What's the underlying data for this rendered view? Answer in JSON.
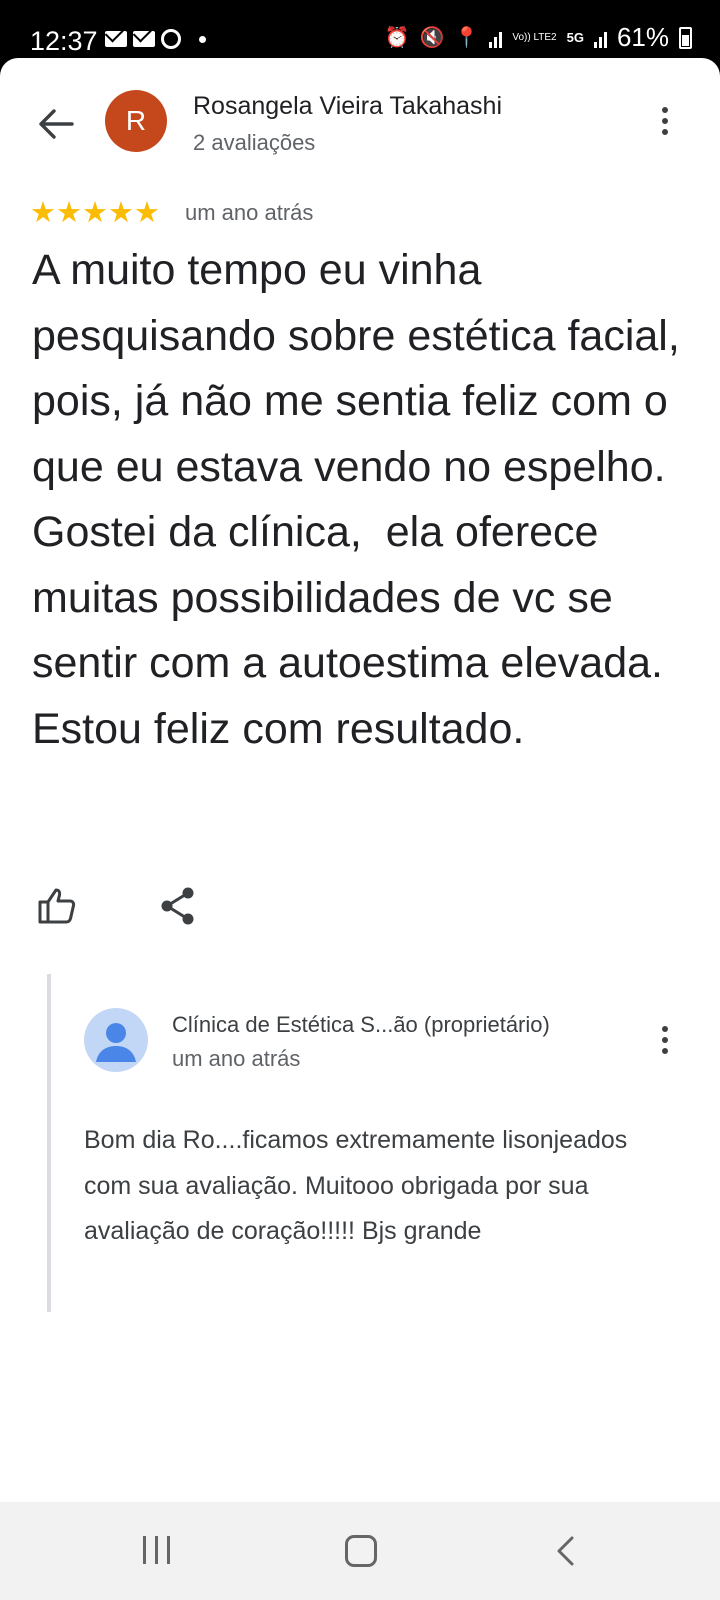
{
  "status_bar": {
    "time": "12:37",
    "battery": "61%",
    "left_icons": [
      "mail-icon",
      "mail-icon",
      "whatsapp-icon",
      "dot"
    ],
    "right_icons": [
      "alarm-icon",
      "mute-icon",
      "location-icon",
      "signal-icon",
      "volte-icon",
      "5g-icon",
      "signal-icon",
      "battery-icon"
    ],
    "volte_label": "Vo)) LTE2",
    "net_label": "5G"
  },
  "review": {
    "author_initial": "R",
    "author_name": "Rosangela Vieira Takahashi",
    "author_review_count": "2 avaliações",
    "avatar_color": "#c5471c",
    "rating": 5,
    "stars": "★★★★★",
    "time": "um ano atrás",
    "text": "A muito tempo eu vinha pesquisando sobre estética facial, pois, já não me sentia feliz com o que eu estava vendo no espelho.  Gostei da clínica,  ela oferece muitas possibilidades de vc se sentir com a autoestima elevada. Estou feliz com resultado."
  },
  "actions": {
    "like_icon": "thumb-up-icon",
    "share_icon": "share-icon"
  },
  "owner_reply": {
    "name": "Clínica de Estética S...ão (proprietário)",
    "time": "um ano atrás",
    "text": "Bom dia Ro....ficamos extremamente lisonjeados com sua avaliação. Muitooo obrigada por sua avaliação de coração!!!!! Bjs grande"
  },
  "colors": {
    "star": "#fbbc04",
    "secondary_text": "#5f6368",
    "primary_text": "#202124"
  }
}
